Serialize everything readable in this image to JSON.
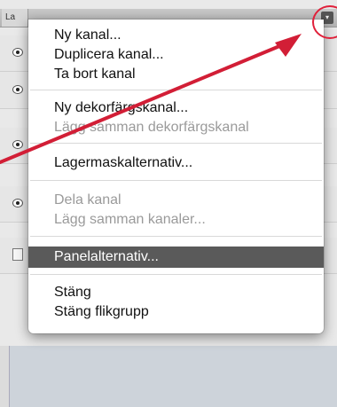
{
  "panel": {
    "tab_label": "La"
  },
  "menu": {
    "items": [
      {
        "label": "Ny kanal...",
        "enabled": true
      },
      {
        "label": "Duplicera kanal...",
        "enabled": true
      },
      {
        "label": "Ta bort kanal",
        "enabled": true
      },
      {
        "label": "Ny dekorfärgskanal...",
        "enabled": true
      },
      {
        "label": "Lägg samman dekorfärgskanal",
        "enabled": false
      },
      {
        "label": "Lagermaskalternativ...",
        "enabled": true
      },
      {
        "label": "Dela kanal",
        "enabled": false
      },
      {
        "label": "Lägg samman kanaler...",
        "enabled": false
      },
      {
        "label": "Panelalternativ...",
        "enabled": true,
        "highlighted": true
      },
      {
        "label": "Stäng",
        "enabled": true
      },
      {
        "label": "Stäng flikgrupp",
        "enabled": true
      }
    ]
  },
  "colors": {
    "annotation": "#e0203a",
    "highlight": "#5a5a5a"
  },
  "icons": [
    "eye-icon",
    "panel-menu-icon"
  ]
}
